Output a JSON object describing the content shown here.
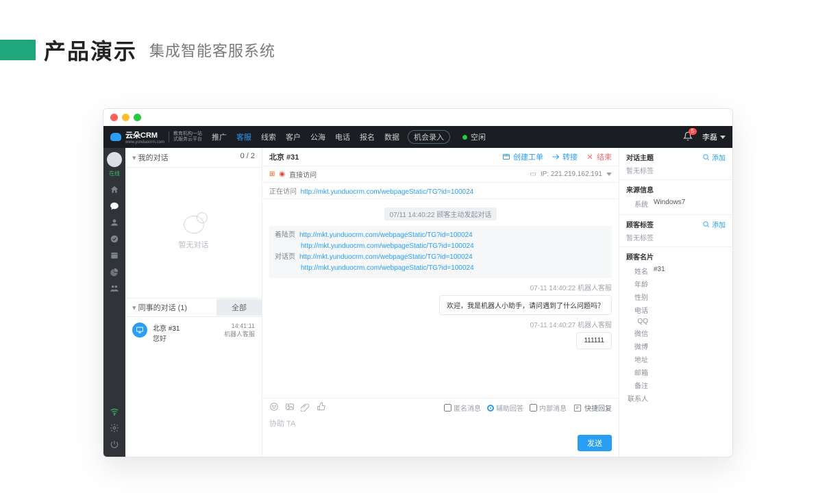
{
  "slide": {
    "title": "产品演示",
    "subtitle": "集成智能客服系统"
  },
  "brand": {
    "name": "云朵CRM",
    "site": "www.yunduocrm.com",
    "tagline1": "教育机构一站",
    "tagline2": "式服务云平台"
  },
  "nav": {
    "items": [
      "推广",
      "客服",
      "线索",
      "客户",
      "公海",
      "电话",
      "报名",
      "数据"
    ],
    "active_index": 1,
    "record_btn": "机会录入",
    "status": "空闲",
    "bell_count": "5",
    "user": "李磊"
  },
  "rail": {
    "online": "在线"
  },
  "convlist": {
    "mine_header": "我的对话",
    "mine_count": "0 / 2",
    "empty": "暂无对话",
    "colleague_header": "同事的对话  (1)",
    "all_btn": "全部",
    "item": {
      "title": "北京 #31",
      "sub": "您好",
      "time": "14:41:11",
      "agent": "机器人客服"
    }
  },
  "chat": {
    "title": "北京 #31",
    "actions": {
      "ticket": "创建工单",
      "transfer": "转接",
      "end": "结束"
    },
    "access_type": "直接访问",
    "ip_label": "IP:",
    "ip": "221.219.162.191",
    "visiting_label": "正在访问",
    "visiting_url": "http://mkt.yunduocrm.com/webpageStatic/TG?id=100024",
    "sys_pill": "07/11 14:40:22  顾客主动发起对话",
    "ref": {
      "landing_label": "着陆页",
      "landing_url1": "http://mkt.yunduocrm.com/webpageStatic/TG?id=100024",
      "landing_url2": "http://mkt.yunduocrm.com/webpageStatic/TG?id=100024",
      "dialog_label": "对话页",
      "dialog_url1": "http://mkt.yunduocrm.com/webpageStatic/TG?id=100024",
      "dialog_url2": "http://mkt.yunduocrm.com/webpageStatic/TG?id=100024"
    },
    "m1_meta": "07-11 14:40:22  机器人客服",
    "m1_text": "欢迎，我是机器人小助手，请问遇到了什么问题吗？",
    "m2_meta": "07-11 14:40:27  机器人客服",
    "m2_text": "111111",
    "opts": {
      "anon": "匿名消息",
      "assist": "辅助回答",
      "internal": "内部消息",
      "quick": "快捷回复"
    },
    "placeholder": "协助 TA",
    "send": "发送"
  },
  "rpanel": {
    "topic_h": "对话主题",
    "add": "添加",
    "no_tag": "暂无标签",
    "source_h": "来源信息",
    "system_k": "系统",
    "system_v": "Windows7",
    "cust_tag_h": "顾客标签",
    "card_h": "顾客名片",
    "card": {
      "name_k": "姓名",
      "name_v": "#31",
      "age_k": "年龄",
      "sex_k": "性别",
      "phone_k": "电话",
      "qq_k": "QQ",
      "wechat_k": "微信",
      "weibo_k": "微博",
      "addr_k": "地址",
      "email_k": "邮箱",
      "remark_k": "备注",
      "contact_k": "联系人"
    }
  }
}
